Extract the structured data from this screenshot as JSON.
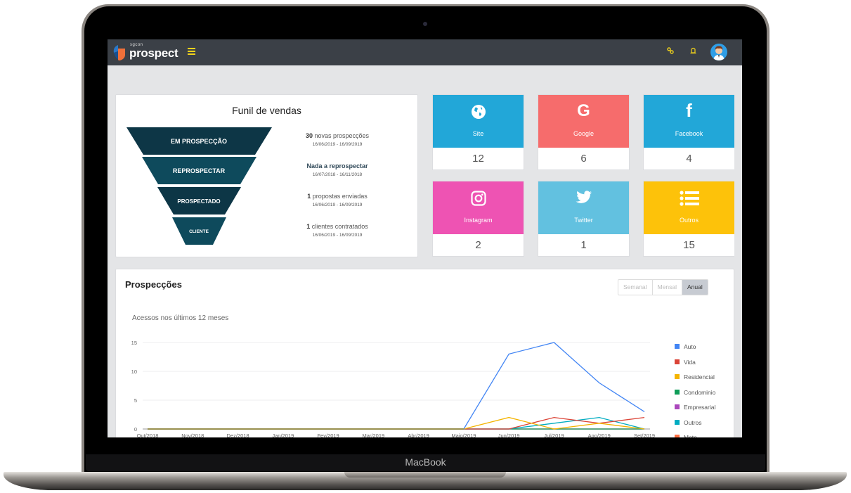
{
  "device": {
    "brand_label": "MacBook"
  },
  "topbar": {
    "logo_small": "sgcon",
    "logo_text": "prospect",
    "icons": [
      "menu-icon",
      "key-icon",
      "bell-icon",
      "user-avatar"
    ]
  },
  "funnel": {
    "title": "Funil de vendas",
    "stages": [
      {
        "label": "EM PROSPECÇÃO",
        "color": "#0d3646"
      },
      {
        "label": "REPROSPECTAR",
        "color": "#0e4a5c"
      },
      {
        "label": "PROSPECTADO",
        "color": "#0d3646"
      },
      {
        "label": "CLIENTE",
        "color": "#0e4a5c"
      }
    ],
    "stats": [
      {
        "count": "30",
        "text": " novas prospecções",
        "date": "16/06/2019 - 16/09/2019"
      },
      {
        "count": "",
        "text": "Nada a reprospectar",
        "date": "16/07/2018 - 16/11/2018"
      },
      {
        "count": "1",
        "text": " propostas enviadas",
        "date": "16/06/2019 - 16/09/2019"
      },
      {
        "count": "1",
        "text": " clientes contratados",
        "date": "16/06/2019 - 16/09/2019"
      }
    ]
  },
  "sources": [
    {
      "label": "Site",
      "value": "12",
      "color": "#22a7d8",
      "icon": "globe-icon"
    },
    {
      "label": "Google",
      "value": "6",
      "color": "#f66c6c",
      "icon": "google-icon"
    },
    {
      "label": "Facebook",
      "value": "4",
      "color": "#22a7d8",
      "icon": "facebook-icon"
    },
    {
      "label": "Instagram",
      "value": "2",
      "color": "#ee53b3",
      "icon": "instagram-icon"
    },
    {
      "label": "Twitter",
      "value": "1",
      "color": "#62c1e0",
      "icon": "twitter-icon"
    },
    {
      "label": "Outros",
      "value": "15",
      "color": "#fdc20a",
      "icon": "list-icon"
    }
  ],
  "prospeccoes": {
    "title": "Prospecções",
    "periods": [
      {
        "label": "Semanal",
        "active": false
      },
      {
        "label": "Mensal",
        "active": false
      },
      {
        "label": "Anual",
        "active": true
      }
    ]
  },
  "chart_data": {
    "type": "line",
    "title": "Acessos nos últimos 12 meses",
    "xlabel": "",
    "ylabel": "",
    "x": [
      "Out/2018",
      "Nov/2018",
      "Dez/2018",
      "Jan/2019",
      "Fev/2019",
      "Mar/2019",
      "Abr/2019",
      "Maio/2019",
      "Jun/2019",
      "Jul/2019",
      "Ago/2019",
      "Set/2019"
    ],
    "yticks": [
      0,
      5,
      10,
      15
    ],
    "ylim": [
      0,
      15
    ],
    "grid": true,
    "legend_position": "right",
    "series": [
      {
        "name": "Auto",
        "color": "#4285f4",
        "values": [
          0,
          0,
          0,
          0,
          0,
          0,
          0,
          0,
          13,
          15,
          8,
          3
        ]
      },
      {
        "name": "Vida",
        "color": "#db4437",
        "values": [
          0,
          0,
          0,
          0,
          0,
          0,
          0,
          0,
          0,
          2,
          1,
          2
        ]
      },
      {
        "name": "Residencial",
        "color": "#f4b400",
        "values": [
          0,
          0,
          0,
          0,
          0,
          0,
          0,
          0,
          2,
          0,
          1,
          0
        ]
      },
      {
        "name": "Condominio",
        "color": "#0f9d58",
        "values": [
          0,
          0,
          0,
          0,
          0,
          0,
          0,
          0,
          0,
          0,
          0,
          0
        ]
      },
      {
        "name": "Empresarial",
        "color": "#ab47bc",
        "values": [
          0,
          0,
          0,
          0,
          0,
          0,
          0,
          0,
          0,
          0,
          0,
          0
        ]
      },
      {
        "name": "Outros",
        "color": "#00acc1",
        "values": [
          0,
          0,
          0,
          0,
          0,
          0,
          0,
          0,
          0,
          1,
          2,
          0
        ]
      },
      {
        "name": "Moto",
        "color": "#ff7043",
        "values": [
          0,
          0,
          0,
          0,
          0,
          0,
          0,
          0,
          0,
          0,
          0,
          0
        ]
      }
    ]
  }
}
